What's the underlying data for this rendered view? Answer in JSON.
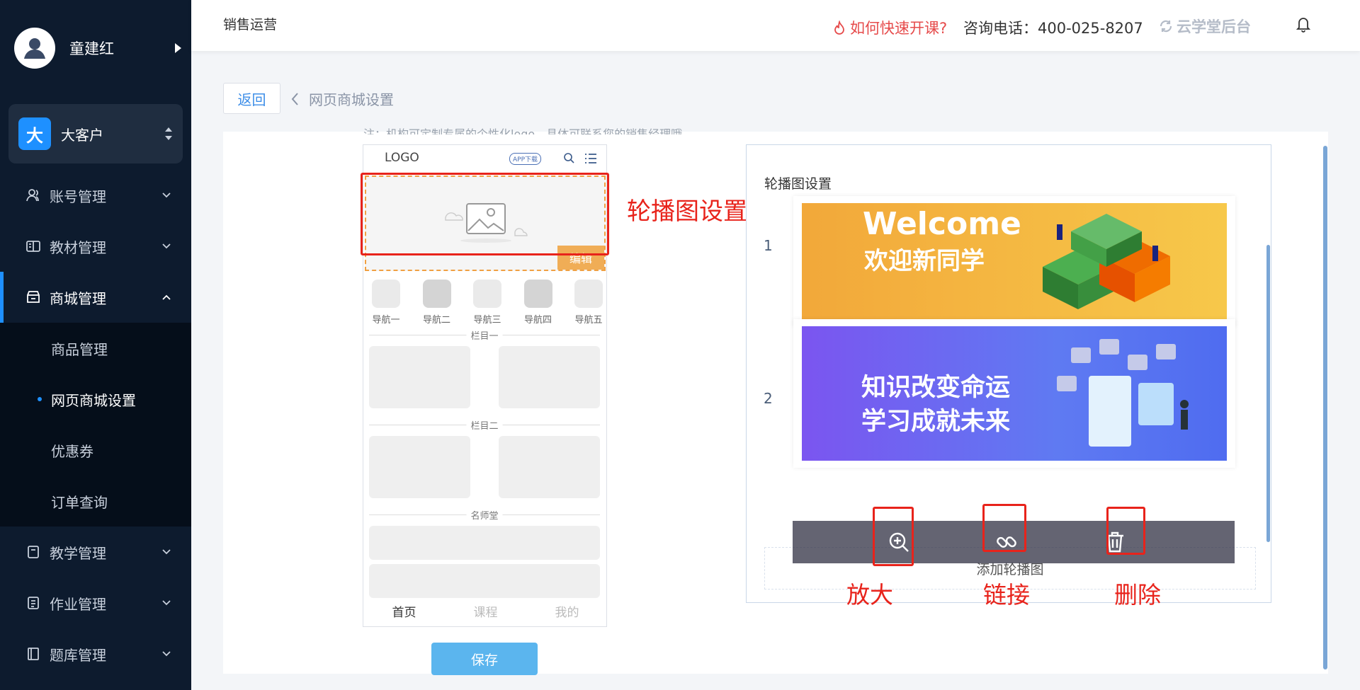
{
  "sidebar": {
    "user_name": "童建红",
    "org_badge": "大",
    "org_name": "大客户",
    "nav": [
      {
        "label": "账号管理"
      },
      {
        "label": "教材管理"
      },
      {
        "label": "商城管理"
      },
      {
        "label": "教学管理"
      },
      {
        "label": "作业管理"
      },
      {
        "label": "题库管理"
      }
    ],
    "mall_sub": [
      {
        "label": "商品管理"
      },
      {
        "label": "网页商城设置"
      },
      {
        "label": "优惠券"
      },
      {
        "label": "订单查询"
      }
    ]
  },
  "header": {
    "title": "销售运营",
    "quick_link": "如何快速开课?",
    "phone": "咨询电话：400-025-8207",
    "brand": "云学堂后台"
  },
  "page": {
    "back_label": "返回",
    "breadcrumb": "网页商城设置",
    "note": "注：机构可定制专属的个性化logo，具体可联系您的销售经理哦"
  },
  "phone_preview": {
    "logo": "LOGO",
    "app_download": "APP下载",
    "edit_label": "编辑",
    "nav_items": [
      "导航一",
      "导航二",
      "导航三",
      "导航四",
      "导航五"
    ],
    "section1": "栏目一",
    "section2": "栏目二",
    "section3": "名师堂",
    "tabs": [
      "首页",
      "课程",
      "我的"
    ]
  },
  "save_label": "保存",
  "annotations": {
    "banner_area": "轮播图设置区域",
    "zoom": "放大",
    "link": "链接",
    "delete": "删除"
  },
  "carousel": {
    "title": "轮播图设置",
    "items": [
      {
        "index": "1",
        "title": "Welcome",
        "subtitle": "欢迎新同学"
      },
      {
        "index": "2",
        "line1": "知识改变命运",
        "line2": "学习成就未来"
      }
    ],
    "add_label": "添加轮播图"
  },
  "colors": {
    "sidebar_bg": "#0d1b2e",
    "accent": "#1e90ff",
    "annotation_red": "#e8231b"
  }
}
